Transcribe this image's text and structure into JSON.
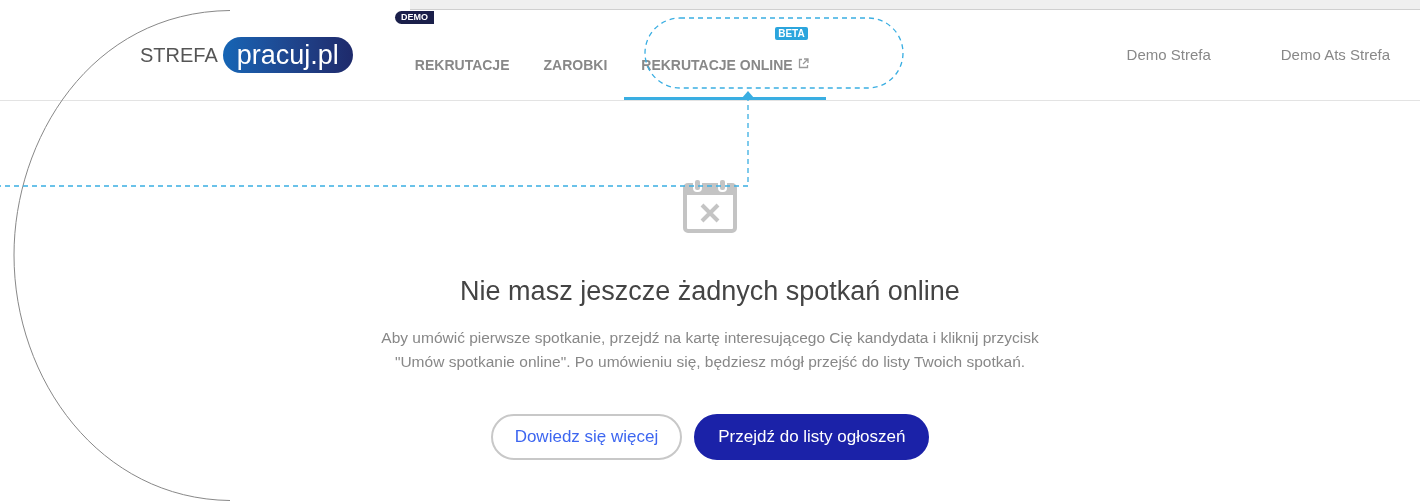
{
  "logo": {
    "prefix": "STREFA",
    "brand": "pracuj.pl",
    "badge": "DEMO"
  },
  "nav": [
    {
      "label": "REKRUTACJE",
      "selected": false
    },
    {
      "label": "ZAROBKI",
      "selected": false
    },
    {
      "label": "REKRUTACJE ONLINE",
      "selected": true,
      "badge": "BETA",
      "external": true
    }
  ],
  "account_links": [
    "Demo Strefa",
    "Demo Ats Strefa"
  ],
  "empty_state": {
    "title": "Nie masz jeszcze żadnych spotkań online",
    "text": "Aby umówić pierwsze spotkanie, przejdź na kartę interesującego Cię kandydata i kliknij przycisk\n\"Umów spotkanie online\". Po umówieniu się, będziesz mógł przejść do listy Twoich spotkań.",
    "buttons": [
      {
        "label": "Dowiedz się więcej",
        "kind": "secondary"
      },
      {
        "label": "Przejdź do listy ogłoszeń",
        "kind": "primary"
      }
    ]
  }
}
